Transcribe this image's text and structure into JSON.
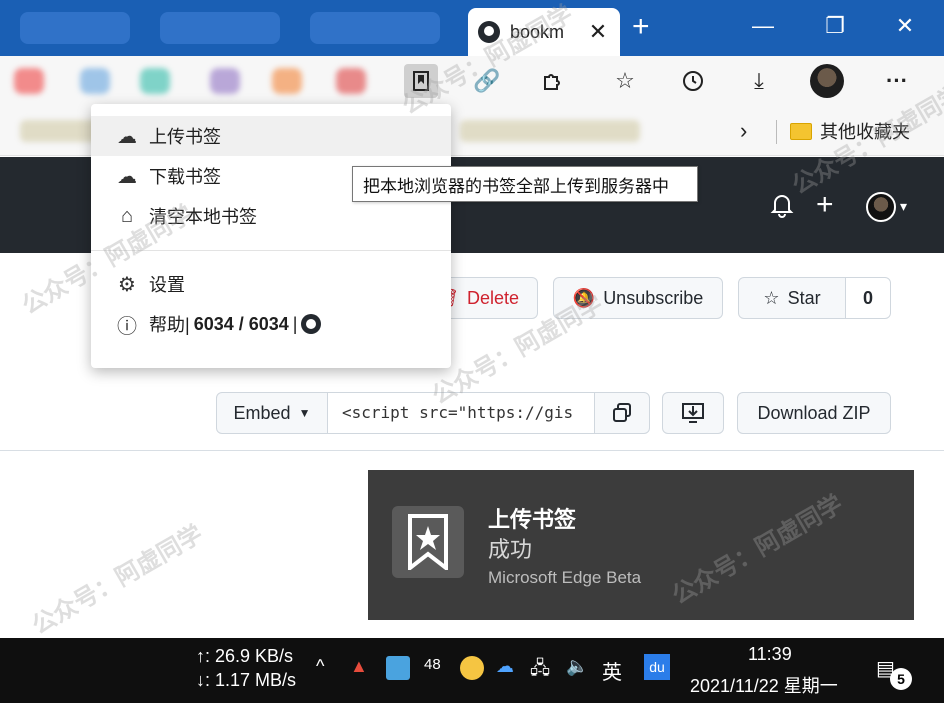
{
  "browser": {
    "tab_title": "bookm",
    "tab_close": "✕",
    "new_tab": "+",
    "window_minimize": "—",
    "window_restore": "❐",
    "window_close": "✕"
  },
  "toolbar": {
    "bookmark_ext_icon": "bookmark-extension-icon",
    "link_icon": "link-icon",
    "extensions_icon": "puzzle-icon",
    "favorites_icon": "favorites-star-icon",
    "history_icon": "history-icon",
    "downloads_icon": "download-icon",
    "more_label": "···"
  },
  "bookmarks_bar": {
    "chevron": "›",
    "other_favorites": "其他收藏夹"
  },
  "menu": {
    "upload": "上传书签",
    "download": "下载书签",
    "clear": "清空本地书签",
    "settings": "设置",
    "help_prefix": "帮助|",
    "help_count": "6034 / 6034",
    "help_suffix": "|"
  },
  "tooltip": "把本地浏览器的书签全部上传到服务器中",
  "gist": {
    "delete": "Delete",
    "unsubscribe": "Unsubscribe",
    "star": "Star",
    "star_count": "0",
    "embed": "Embed",
    "embed_value": "<script src=\"https://gis",
    "download_zip": "Download ZIP"
  },
  "toast": {
    "title": "上传书签",
    "body": "成功",
    "app": "Microsoft Edge Beta"
  },
  "taskbar": {
    "net_up": "↑: 26.9 KB/s",
    "net_down": "↓: 1.17 MB/s",
    "tray_chevron": "^",
    "tray_48": "48",
    "ime": "英",
    "du": "du",
    "time": "11:39",
    "date": "2021/11/22 星期一",
    "notif_count": "5"
  },
  "watermark": "公众号：阿虚同学",
  "colors": {
    "titlebar": "#1a5fb4",
    "github_header": "#24292f",
    "delete_red": "#cf222e",
    "toast_bg": "#3c3c3c",
    "taskbar": "#0f0f0f"
  }
}
